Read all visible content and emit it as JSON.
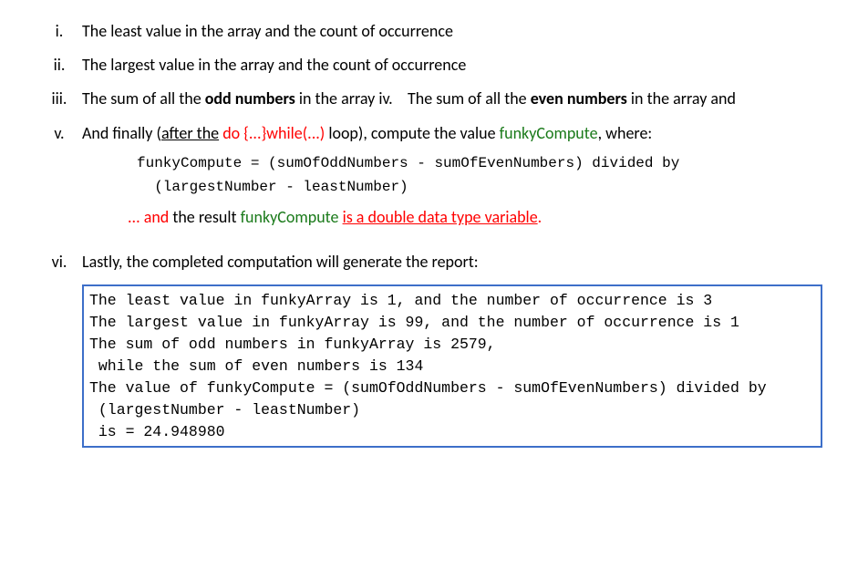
{
  "items": {
    "i": {
      "roman": "i.",
      "text": "The least value in the array and the count of occurrence"
    },
    "ii": {
      "roman": "ii.",
      "text": "The largest value in the array and the count of occurrence"
    },
    "iii": {
      "roman": "iii.",
      "part1": "The sum of all the ",
      "bold1": "odd numbers",
      "part2": " in the array ",
      "ivlabel": "iv.",
      "part3": "The sum of all the ",
      "bold2": "even numbers",
      "part4": " in the array and"
    },
    "v": {
      "roman": "v.",
      "seg_and_finally": "And finally (",
      "seg_after_the": "after the",
      "seg_space1": " ",
      "seg_do": "do {...}while(...)",
      "seg_loop": " loop),  compute the value ",
      "seg_funky": "funkyCompute",
      "seg_where": ", where:",
      "formula_line1": "funkyCompute = (sumOfOddNumbers - sumOfEvenNumbers) divided by",
      "formula_line2": "  (largestNumber - leastNumber)",
      "result_dots": "... and",
      "result_mid": " the result ",
      "result_funky": "funkyCompute",
      "result_space": " ",
      "result_type": "is a double data type variable",
      "result_dot": "."
    },
    "vi": {
      "roman": "vi.",
      "text": "Lastly, the completed computation will generate the report:"
    }
  },
  "output": {
    "line1": "The least value in funkyArray is 1, and the number of occurrence is 3",
    "line2": "The largest value in funkyArray is 99, and the number of occurrence is 1",
    "line3": "The sum of odd numbers in funkyArray is 2579,",
    "line4": " while the sum of even numbers is 134",
    "line5": "The value of funkyCompute = (sumOfOddNumbers - sumOfEvenNumbers) divided by",
    "line6": " (largestNumber - leastNumber)",
    "line7": " is = 24.948980"
  }
}
